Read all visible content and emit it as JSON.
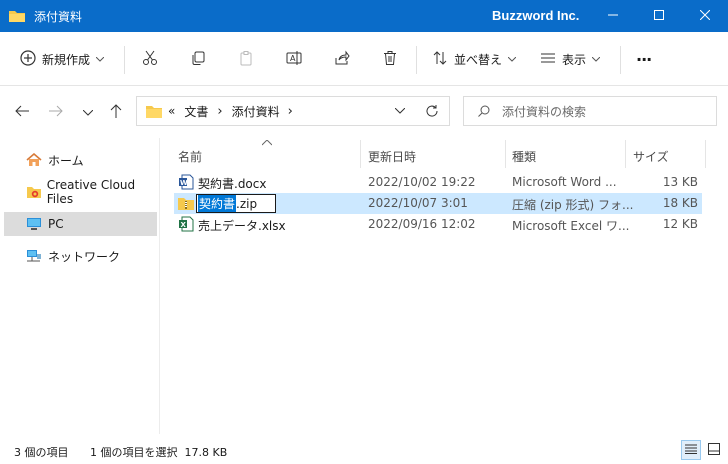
{
  "window": {
    "title": "添付資料",
    "brand": "Buzzword Inc.",
    "minimize_icon": "minimize-icon",
    "maximize_icon": "maximize-icon",
    "close_icon": "close-icon"
  },
  "toolbar": {
    "new_label": "新規作成",
    "sort_label": "並べ替え",
    "view_label": "表示",
    "more_label": "···"
  },
  "address": {
    "prefix": "«",
    "crumbs": [
      "文書",
      "添付資料"
    ],
    "separator": "›"
  },
  "search": {
    "placeholder": "添付資料の検索"
  },
  "sidebar": {
    "items": [
      {
        "label": "ホーム",
        "icon": "home-icon"
      },
      {
        "label": "Creative Cloud Files",
        "icon": "creative-cloud-icon"
      },
      {
        "label": "PC",
        "icon": "pc-icon"
      },
      {
        "label": "ネットワーク",
        "icon": "network-icon"
      }
    ]
  },
  "columns": {
    "name": "名前",
    "modified": "更新日時",
    "type": "種類",
    "size": "サイズ"
  },
  "files": [
    {
      "name": "契約書.docx",
      "modified": "2022/10/02 19:22",
      "type": "Microsoft Word ...",
      "size": "13 KB",
      "icon": "word-file-icon"
    },
    {
      "name_selected": "契約書",
      "name_rest": ".zip",
      "modified": "2022/10/07 3:01",
      "type": "圧縮 (zip 形式) フォ...",
      "size": "18 KB",
      "icon": "zip-folder-icon"
    },
    {
      "name": "売上データ.xlsx",
      "modified": "2022/09/16 12:02",
      "type": "Microsoft Excel ワ...",
      "size": "12 KB",
      "icon": "excel-file-icon"
    }
  ],
  "status": {
    "count": "3 個の項目",
    "selection": "1 個の項目を選択  17.8 KB"
  },
  "colors": {
    "titlebar": "#0a6cc9",
    "selection": "#cce8ff",
    "rename_highlight": "#0078d7"
  }
}
